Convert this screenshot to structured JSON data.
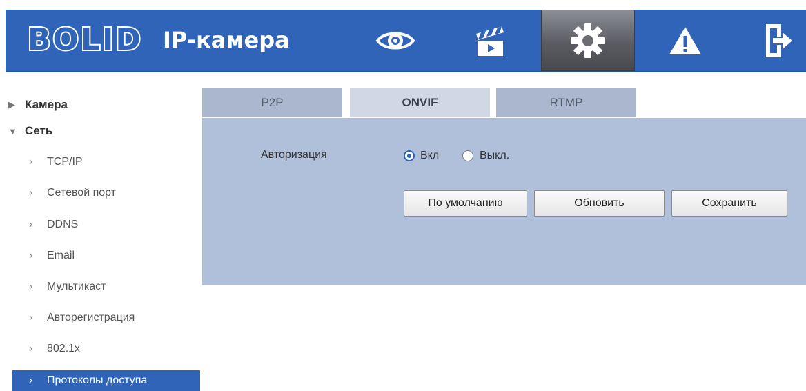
{
  "header": {
    "logo_text": "BOLID",
    "app_title": "IP-камера",
    "nav": [
      {
        "icon": "eye-icon"
      },
      {
        "icon": "clapperboard-icon"
      },
      {
        "icon": "gear-icon"
      },
      {
        "icon": "warning-icon"
      },
      {
        "icon": "logout-icon"
      }
    ]
  },
  "sidebar": {
    "groups": [
      {
        "label": "Камера",
        "expanded": false
      },
      {
        "label": "Сеть",
        "expanded": true
      }
    ],
    "items": [
      {
        "label": "TCP/IP"
      },
      {
        "label": "Сетевой порт"
      },
      {
        "label": "DDNS"
      },
      {
        "label": "Email"
      },
      {
        "label": "Мультикаст"
      },
      {
        "label": "Авторегистрация"
      },
      {
        "label": "802.1x"
      },
      {
        "label": "Протоколы доступа",
        "active": true
      }
    ]
  },
  "tabs": [
    {
      "label": "P2P"
    },
    {
      "label": "ONVIF",
      "active": true
    },
    {
      "label": "RTMP"
    }
  ],
  "form": {
    "auth_label": "Авторизация",
    "auth_on_label": "Вкл",
    "auth_off_label": "Выкл.",
    "auth_value": "Вкл"
  },
  "buttons": {
    "default_label": "По умолчанию",
    "refresh_label": "Обновить",
    "save_label": "Сохранить"
  },
  "colors": {
    "header_bg": "#2f64b9",
    "active_item_bg": "#2f64b9",
    "panel_bg": "#b0c0da"
  }
}
